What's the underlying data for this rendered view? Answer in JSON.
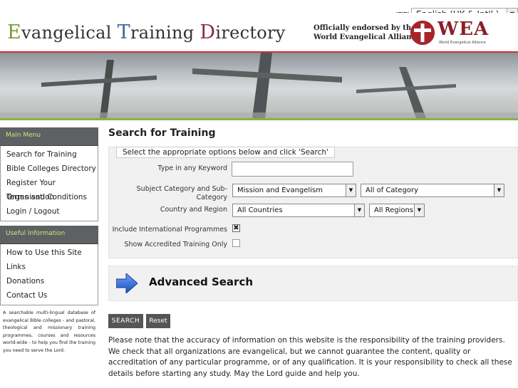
{
  "language": {
    "selected": "English (UK & Int'l.)",
    "flag_icon": "uk-flag-icon"
  },
  "header": {
    "logo": {
      "word1_cap": "E",
      "word1_rest": "vangelical ",
      "word2_cap": "T",
      "word2_rest": "raining ",
      "word3_cap": "D",
      "word3_rest": "irectory"
    },
    "endorse_line1": "Officially endorsed by the",
    "endorse_line2": "World Evangelical Alliance",
    "wea_text": "WEA",
    "wea_sub": "World Evangelical Alliance"
  },
  "sidebar": {
    "main_menu_title": "Main Menu",
    "main_menu": [
      {
        "label": "Search for Training"
      },
      {
        "label": "Bible Colleges Directory"
      },
      {
        "label": "Register Your Organisation"
      },
      {
        "label": "Terms and Conditions"
      },
      {
        "label": "Login / Logout"
      }
    ],
    "useful_title": "Useful Information",
    "useful": [
      {
        "label": "How to Use this Site"
      },
      {
        "label": "Links"
      },
      {
        "label": "Donations"
      },
      {
        "label": "Contact Us"
      }
    ],
    "description": "A searchable multi-lingual database of evangelical Bible colleges - and pastoral, theological and missionary training programmes, courses and resources world-wide - to help you find the training you need to serve the Lord."
  },
  "main": {
    "title": "Search for Training",
    "form": {
      "legend": "Select the appropriate options below and click 'Search'",
      "keyword_label": "Type in any Keyword",
      "keyword_value": "",
      "category_label_1": "Subject Category and Sub-",
      "category_label_2": "Category",
      "category_value": "Mission and Evangelism",
      "subcategory_value": "All of Category",
      "country_label": "Country and Region",
      "country_value": "All Countries",
      "region_value": "All Regions",
      "international_label": "Include International Programmes",
      "international_checked": "✖",
      "accredited_label": "Show Accredited Training Only"
    },
    "advanced_search": "Advanced Search",
    "search_button": "SEARCH",
    "reset_button": "Reset",
    "disclaimer": "Please note that the accuracy of information on this website is the responsibility of the training providers. We check that all organizations are evangelical, but we cannot guarantee the content, quality or accreditation of any particular programme, or of any qualification. It is your responsibility to check all these details before starting any study. May the Lord guide and help you."
  },
  "colors": {
    "accent_red": "#c33333",
    "accent_green": "#8ab04a",
    "menu_header_bg": "#5d6163",
    "menu_header_text": "#d4e07a",
    "advanced_arrow": "#2a62c4"
  }
}
